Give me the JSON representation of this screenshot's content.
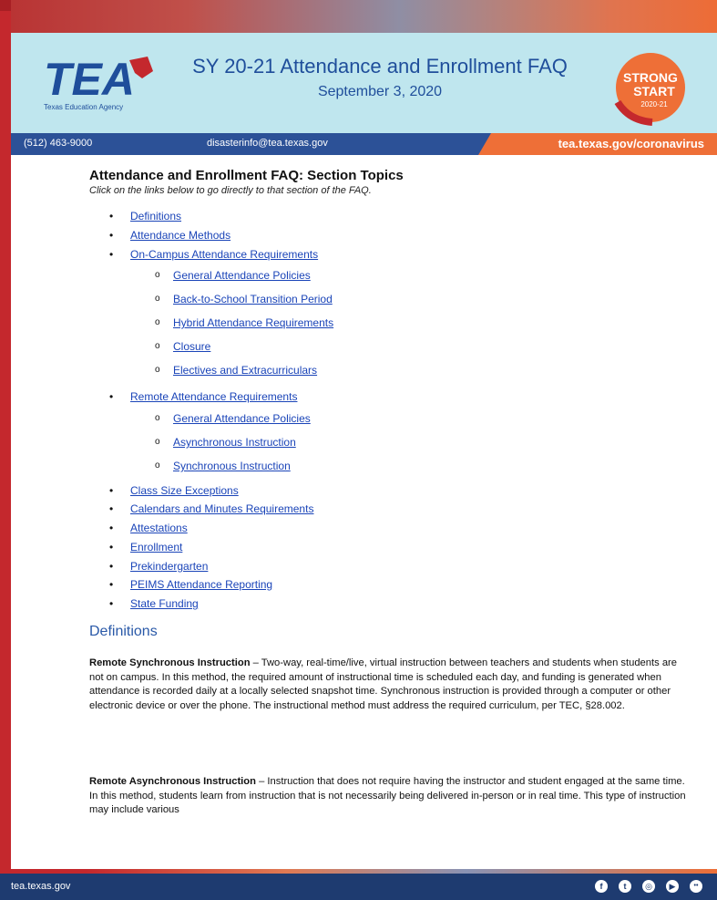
{
  "header": {
    "logo_text": "TEA",
    "logo_subtext": "Texas Education Agency",
    "title": "SY 20-21 Attendance and Enrollment FAQ",
    "date": "September 3, 2020",
    "badge_line1": "STRONG",
    "badge_line2": "START",
    "badge_line3": "2020-21"
  },
  "contact": {
    "phone": "(512) 463-9000",
    "email": "disasterinfo@tea.texas.gov",
    "web": "tea.texas.gov/coronavirus"
  },
  "toc": {
    "title": "Attendance and Enrollment FAQ: Section Topics",
    "subtitle": "Click on the links below to go directly to that section of the FAQ.",
    "items": [
      "Definitions",
      "Attendance Methods",
      "On-Campus Attendance Requirements",
      "General Attendance Policies",
      "Back-to-School Transition Period",
      "Hybrid Attendance Requirements",
      "Closure",
      "Electives and Extracurriculars",
      "Remote Attendance Requirements",
      "General Attendance Policies",
      "Asynchronous Instruction",
      "Synchronous Instruction",
      "Class Size Exceptions",
      "Calendars and Minutes Requirements",
      "Attestations",
      "Enrollment",
      "Prekindergarten",
      "PEIMS Attendance Reporting",
      "State Funding"
    ]
  },
  "definitions": {
    "heading": "Definitions",
    "p1_term": "Remote Synchronous Instruction",
    "p1_body": " – Two-way, real-time/live, virtual instruction between teachers and students when students are not on campus. In this method, the required amount of instructional time is scheduled each day, and funding is generated when attendance is recorded daily at a locally selected snapshot time. Synchronous instruction is provided through a computer or other electronic device or over the phone. The instructional method must address the required curriculum, per TEC, §28.002.",
    "p2_term": "Remote Asynchronous Instruction",
    "p2_body": " – Instruction that does not require having the instructor and student engaged at the same time. In this method, students learn from instruction that is not necessarily being delivered in-person or in real time. This type of instruction may include various"
  },
  "footer": {
    "site": "tea.texas.gov",
    "social_icons": [
      "facebook-icon",
      "twitter-icon",
      "instagram-icon",
      "youtube-icon",
      "flickr-icon"
    ],
    "social_glyphs": [
      "f",
      "t",
      "◎",
      "▶",
      "••"
    ]
  },
  "colors": {
    "header_bg": "#bfe6ee",
    "brand_blue": "#2c5197",
    "brand_orange": "#ee6f37",
    "brand_red": "#c4282d",
    "link_blue": "#1a44b8"
  }
}
